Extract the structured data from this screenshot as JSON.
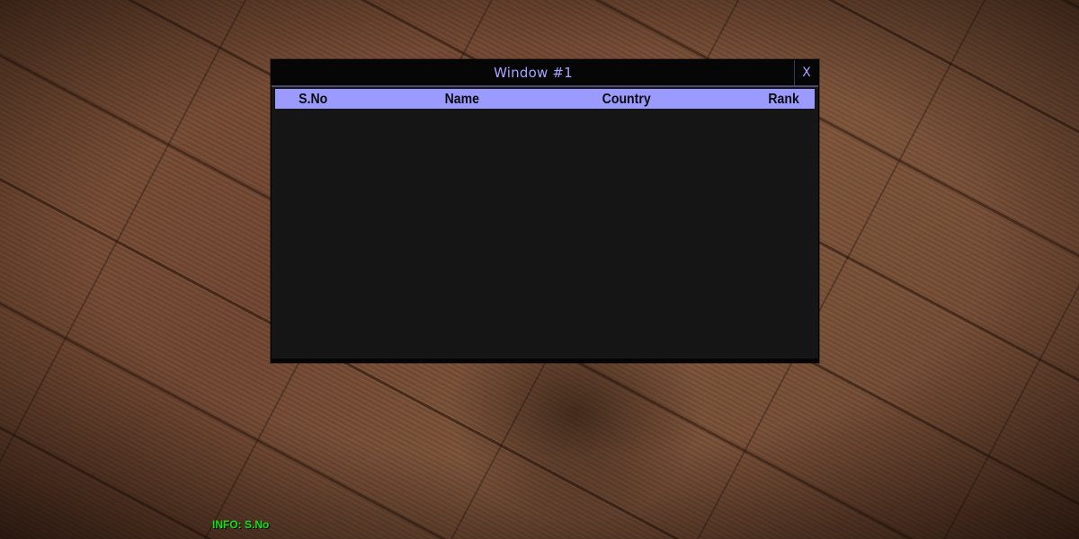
{
  "window": {
    "title": "Window #1",
    "close_label": "X"
  },
  "gridlist": {
    "columns": [
      "S.No",
      "Name",
      "Country",
      "Rank"
    ],
    "rows": []
  },
  "info": {
    "label": "INFO:",
    "value": "S.No"
  },
  "colors": {
    "title_text": "#a9a4ff",
    "header_background": "#9b9bff",
    "panel_background": "#161616",
    "info_text": "#14e014"
  }
}
